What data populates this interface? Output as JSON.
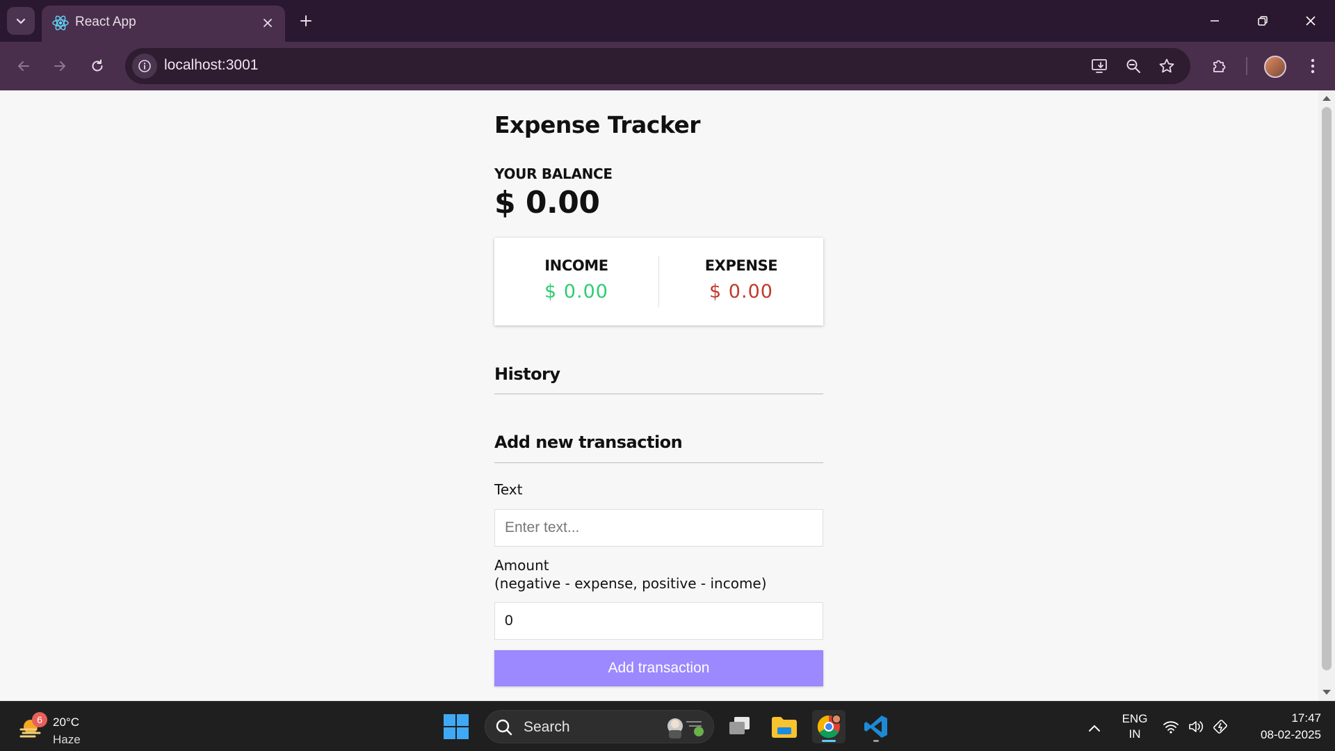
{
  "browser": {
    "tab_title": "React App",
    "url": "localhost:3001"
  },
  "app": {
    "title": "Expense Tracker",
    "balance_label": "YOUR BALANCE",
    "balance_value": "$ 0.00",
    "income_label": "INCOME",
    "income_value": "$ 0.00",
    "expense_label": "EXPENSE",
    "expense_value": "$ 0.00",
    "history_title": "History",
    "add_title": "Add new transaction",
    "text_label": "Text",
    "text_placeholder": "Enter text...",
    "amount_label": "Amount",
    "amount_hint": "(negative - expense, positive - income)",
    "amount_value": "0",
    "add_button": "Add transaction"
  },
  "colors": {
    "income": "#2ecc71",
    "expense": "#c0392b",
    "button": "#9c88ff"
  },
  "taskbar": {
    "weather_badge": "6",
    "weather_temp": "20°C",
    "weather_condition": "Haze",
    "search_label": "Search",
    "lang_1": "ENG",
    "lang_2": "IN",
    "time": "17:47",
    "date": "08-02-2025"
  }
}
